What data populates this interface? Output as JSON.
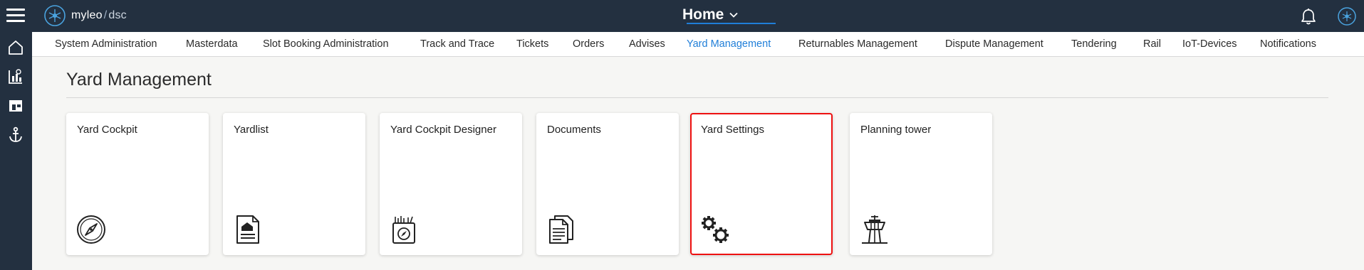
{
  "header": {
    "logo_name": "myleo",
    "logo_separator": "/",
    "logo_suffix": "dsc",
    "page_title": "Home"
  },
  "nav": {
    "tabs": [
      {
        "label": "System Administration"
      },
      {
        "label": "Masterdata"
      },
      {
        "label": "Slot Booking Administration"
      },
      {
        "label": "Track and Trace"
      },
      {
        "label": "Tickets"
      },
      {
        "label": "Orders"
      },
      {
        "label": "Advises"
      },
      {
        "label": "Yard Management",
        "active": true
      },
      {
        "label": "Returnables Management"
      },
      {
        "label": "Dispute Management"
      },
      {
        "label": "Tendering"
      },
      {
        "label": "Rail"
      },
      {
        "label": "IoT-Devices"
      },
      {
        "label": "Notifications"
      }
    ]
  },
  "sidebar": {
    "items": [
      {
        "icon": "home-icon"
      },
      {
        "icon": "analytics-icon"
      },
      {
        "icon": "dashboard-icon"
      },
      {
        "icon": "anchor-icon"
      }
    ]
  },
  "main": {
    "title": "Yard Management",
    "cards": [
      {
        "label": "Yard Cockpit",
        "icon": "compass-icon"
      },
      {
        "label": "Yardlist",
        "icon": "document-house-icon"
      },
      {
        "label": "Yard Cockpit Designer",
        "icon": "designer-compass-icon"
      },
      {
        "label": "Documents",
        "icon": "documents-icon"
      },
      {
        "label": "Yard Settings",
        "icon": "gears-icon",
        "selected": true
      },
      {
        "label": "Planning tower",
        "icon": "control-tower-icon"
      }
    ]
  },
  "colors": {
    "header_bg": "#233040",
    "accent": "#1f7ed8",
    "selection": "#ee1111"
  }
}
